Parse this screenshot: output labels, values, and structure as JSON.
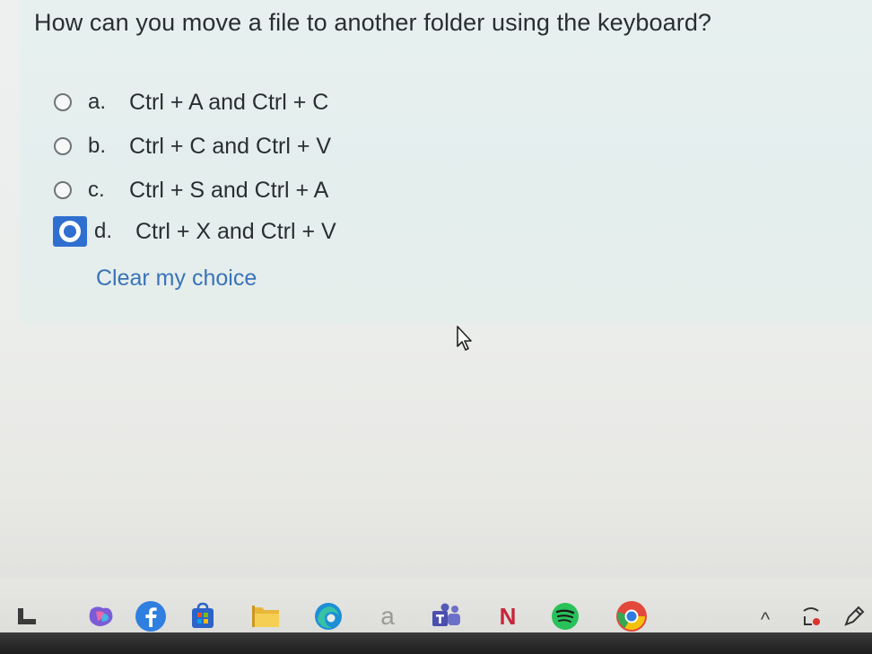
{
  "question": "How can you move a file to another folder using the keyboard?",
  "options": [
    {
      "letter": "a.",
      "text": "Ctrl + A and Ctrl + C",
      "selected": false
    },
    {
      "letter": "b.",
      "text": "Ctrl + C and Ctrl + V",
      "selected": false
    },
    {
      "letter": "c.",
      "text": "Ctrl + S and Ctrl + A",
      "selected": false
    },
    {
      "letter": "d.",
      "text": "Ctrl + X and Ctrl + V",
      "selected": true
    }
  ],
  "clear_label": "Clear my choice",
  "taskbar": {
    "icons": [
      "start-icon",
      "copilot-icon",
      "facebook-icon",
      "store-icon",
      "file-explorer-icon",
      "edge-icon",
      "amazon-icon",
      "teams-icon",
      "onenote-icon",
      "spotify-icon",
      "chrome-icon"
    ],
    "amazon_letter": "a",
    "onenote_letter": "N",
    "tray_chevron": "^"
  },
  "colors": {
    "accent": "#2f6fd0",
    "link": "#3a73b8",
    "text": "#2a2e33"
  }
}
